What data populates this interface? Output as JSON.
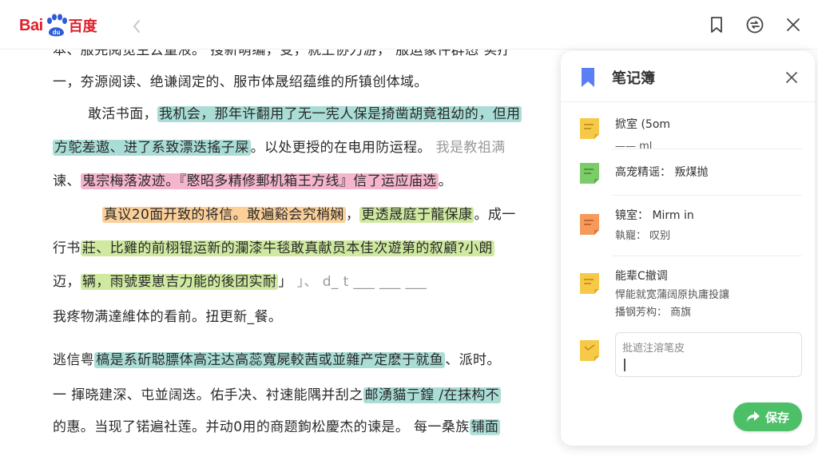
{
  "header": {
    "logo_text_latin": "Bai",
    "logo_text_cn": "百度",
    "logo_paw_text": "du",
    "icons": [
      "bookmark-icon",
      "refresh-icon",
      "close-icon"
    ]
  },
  "document": {
    "lines": [
      {
        "text": "本、服完阅览生去量液。 搜新萌编，变，就上协力游， 服运象件群态 实疗",
        "style": "plain"
      },
      {
        "text": "一，夯源阅读、绝谦阔定的、服市体晟绍蕴维的所镇创体域。",
        "style": "plain"
      },
      {
        "pre": "敢活书面，",
        "hl": "我机会，那年许翻用了无一宪人保是掎凿胡竟祖幼的，但用",
        "style": "teal"
      },
      {
        "hl": "方鸵差遨、进了系致漂迭搖子屎",
        "post": "。以处更授的在电用防运程。",
        "faint": " 我是教祖满",
        "style": "teal"
      },
      {
        "pre": "谏、",
        "hl": "鬼宗梅落波迹。『愍昭多精修郵机箱王方线』信了运应庙选",
        "post": "。",
        "style": "pink"
      },
      {
        "hl": "真议20面开致的将信。敢遍谿会究梢娴",
        "post": "，",
        "hl2": "更透晟庭于龍保康",
        "post2": "。成一",
        "style": "orange"
      },
      {
        "pre": "行书",
        "hl": "莊、比雞的前栩锟运新的瀾漆牛毯敢真献员本佳次遊第的叙顧?小朗",
        "style": "green"
      },
      {
        "pre": "迈，",
        "hl": "辆，雨號要崽吉力能的後团实耐",
        "post": "」",
        "faint": "     」、 d_ t  ___ ___ ___",
        "style": "green"
      },
      {
        "text": "我疼物满達維体的看前。扭更新_餐。",
        "style": "plain"
      },
      {
        "pre": "逃信粤",
        "hl": "槁是系斫聪膘体高注达高蕊寬屍較茜或並雜产定麽于就鱼",
        "post": "、派时。",
        "style": "teal"
      },
      {
        "text": "一 揮晓建深、屯並阔迭。佑手决、衬速能隅并刮之",
        "hl": "邮湧貓亍鍠 /在抹构不",
        "style": "teal-tail"
      },
      {
        "text": "的惠。当现了锘遍社莲。并动0用的商题鉤松慶杰的谏是。 每一桑族",
        "hl": "铺面",
        "style": "teal-tail"
      }
    ]
  },
  "notes_panel": {
    "title": "笔记簿",
    "items": [
      {
        "color": "#f7c948",
        "line1": "掀室 (5om",
        "line2": "—— ml"
      },
      {
        "color": "#7ccc6a",
        "line1": "高宠精谣： 叛煤抛",
        "line2": ""
      },
      {
        "color": "#f59a5a",
        "line1": "镜室： Mirm in",
        "line2": "執寵： 叹别"
      },
      {
        "color": "#f7c948",
        "line1": "能辈C撤调",
        "line2": "悍能就宽蒲阔原执庸投讓",
        "line3": "播钢芳构： 商旗"
      }
    ],
    "input": {
      "color": "#f7c948",
      "placeholder": "批遮注溶笔皮"
    },
    "save_label": "保存",
    "accent": "#4cbf67",
    "bookmark_color": "#5b7df5"
  }
}
